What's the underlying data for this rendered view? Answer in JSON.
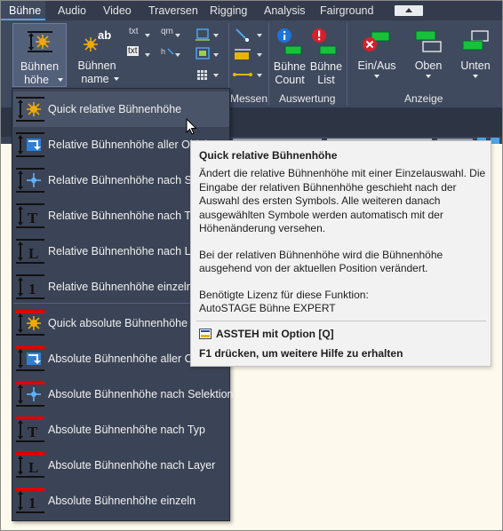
{
  "tabs": [
    "Bühne",
    "Audio",
    "Video",
    "Traversen",
    "Rigging",
    "Analysis",
    "Fairground"
  ],
  "ribbon": {
    "buehnenhoehe": [
      "Bühnen",
      "höhe"
    ],
    "buehnenname": [
      "Bühnen",
      "name"
    ],
    "small_labels": [
      "txt",
      "qm",
      "txt"
    ],
    "buehne_count": [
      "Bühne",
      "Count"
    ],
    "buehne_list": [
      "Bühne",
      "List"
    ],
    "ein_aus": "Ein/Aus",
    "oben": "Oben",
    "unten": "Unten",
    "groups": {
      "messen": "Messen",
      "auswertung": "Auswertung",
      "anzeige": "Anzeige"
    }
  },
  "menu": {
    "relative": [
      "Quick relative Bühnenhöhe",
      "Relative Bühnenhöhe aller Objekte",
      "Relative Bühnenhöhe nach Selektion",
      "Relative Bühnenhöhe nach Typ",
      "Relative Bühnenhöhe nach Layer",
      "Relative Bühnenhöhe einzeln"
    ],
    "absolute": [
      "Quick absolute Bühnenhöhe",
      "Absolute Bühnenhöhe aller Objekte",
      "Absolute Bühnenhöhe nach Selektion",
      "Absolute Bühnenhöhe nach Typ",
      "Absolute Bühnenhöhe nach Layer",
      "Absolute Bühnenhöhe einzeln"
    ]
  },
  "tooltip": {
    "title": "Quick relative Bühnenhöhe",
    "p1": "Ändert die relative Bühnenhöhe mit einer Einzelauswahl. Die Eingabe der relativen Bühnenhöhe geschieht nach der Auswahl des ersten Symbols. Alle weiteren danach ausgewählten Symbole werden automatisch mit der Höhenänderung versehen.",
    "p2": "Bei der relativen Bühnenhöhe wird die Bühnenhöhe ausgehend von der aktuellen Position verändert.",
    "p3_line1": "Benötigte Lizenz für diese Funktion:",
    "p3_line2": "AutoSTAGE Bühne EXPERT",
    "command": "ASSTEH mit Option [Q]",
    "help": "F1 drücken, um weitere Hilfe zu erhalten"
  },
  "colors": {
    "accent_tab": "#4ea3e6",
    "absolute_bar": "#e00000",
    "tooltip_bg": "#f2f2f2",
    "canvas_bg": "#fdf9ec"
  }
}
